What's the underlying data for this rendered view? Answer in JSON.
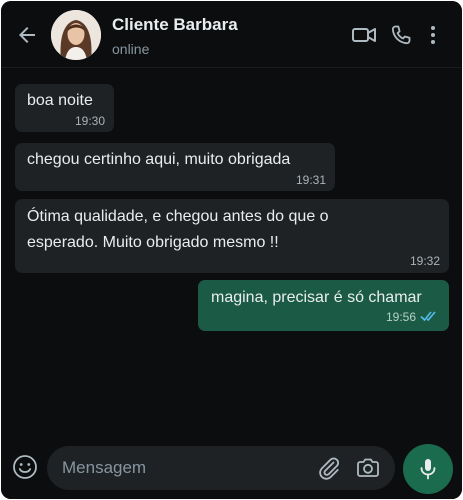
{
  "header": {
    "contact_name": "Cliente Barbara",
    "status": "online"
  },
  "messages": [
    {
      "direction": "incoming",
      "text": "boa noite",
      "time": "19:30"
    },
    {
      "direction": "incoming",
      "text": "chegou certinho aqui, muito obrigada",
      "time": "19:31"
    },
    {
      "direction": "incoming",
      "text_line1": "Ótima qualidade, e chegou antes do que o",
      "text_line2": "esperado. Muito obrigado mesmo !!",
      "time": "19:32"
    },
    {
      "direction": "outgoing",
      "text": "magina, precisar é só chamar",
      "time": "19:56",
      "status": "read"
    }
  ],
  "composer": {
    "placeholder": "Mensagem"
  },
  "colors": {
    "background": "#0b0d0e",
    "incoming_bubble": "#1f2225",
    "outgoing_bubble": "#1b5b45",
    "accent": "#1b6b4e",
    "read_ticks": "#53bdeb"
  }
}
